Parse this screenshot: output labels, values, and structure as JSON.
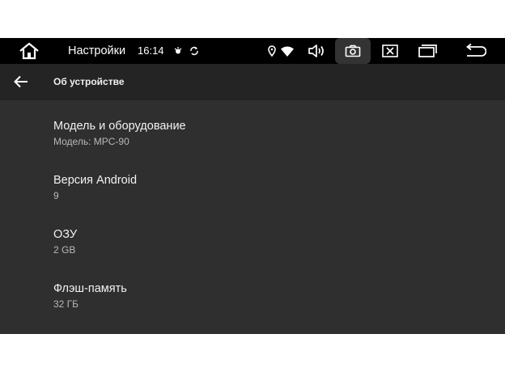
{
  "status_bar": {
    "app_title": "Настройки",
    "time": "16:14",
    "icons": [
      "home-icon",
      "notification-icon",
      "sync-icon",
      "location-icon",
      "wifi-icon",
      "volume-icon",
      "screenshot-icon",
      "close-app-icon",
      "recent-apps-icon",
      "back-icon"
    ]
  },
  "toolbar": {
    "back_icon": "arrow-left-icon",
    "title": "Об устройстве"
  },
  "items": [
    {
      "title": "Модель и оборудование",
      "subtitle": "Модель: MPC-90"
    },
    {
      "title": "Версия Android",
      "subtitle": "9"
    },
    {
      "title": "ОЗУ",
      "subtitle": "2 GB"
    },
    {
      "title": "Флэш-память",
      "subtitle": "32 ГБ"
    }
  ],
  "colors": {
    "status_bar_bg": "#000000",
    "toolbar_bg": "#242424",
    "content_bg": "#2f2f2f",
    "primary_text": "#f2f2f2",
    "secondary_text": "#b8b8b8"
  }
}
